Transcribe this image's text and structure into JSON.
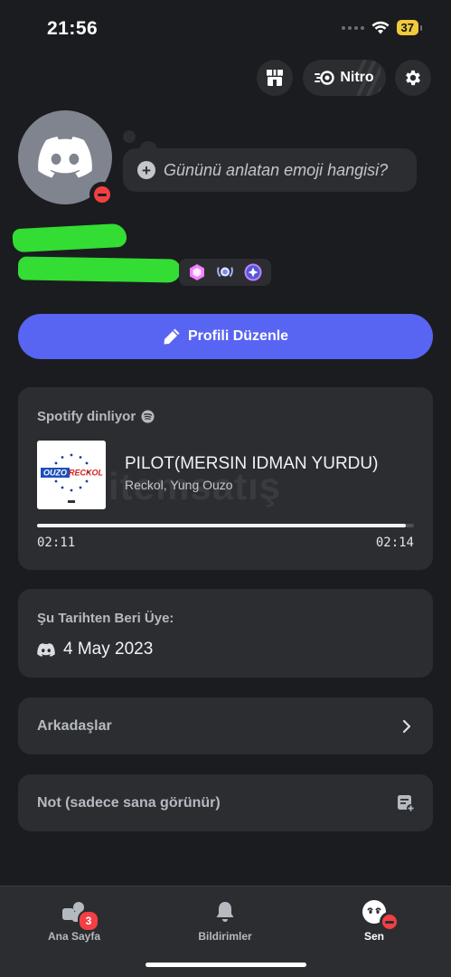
{
  "status_bar": {
    "time": "21:56",
    "battery": "37"
  },
  "header": {
    "nitro_label": "Nitro"
  },
  "profile": {
    "emoji_prompt": "Gününü anlatan emoji hangisi?",
    "edit_button": "Profili Düzenle",
    "badges": [
      "hypesquad-badge",
      "quest-badge",
      "nitro-badge"
    ],
    "status": "do-not-disturb"
  },
  "spotify": {
    "header": "Spotify dinliyor",
    "song_title": "PILOT(MERSIN IDMAN YURDU)",
    "artist": "Reckol, Yung Ouzo",
    "album_logo_text": [
      "OUZO",
      "RECKOL"
    ],
    "elapsed": "02:11",
    "duration": "02:14",
    "progress": 0.978,
    "watermark": "itemsatış"
  },
  "membership": {
    "title": "Şu Tarihten Beri Üye:",
    "date": "4 May 2023"
  },
  "friends": {
    "label": "Arkadaşlar"
  },
  "note": {
    "label": "Not (sadece sana görünür)"
  },
  "tabbar": {
    "home_label": "Ana Sayfa",
    "home_badge": "3",
    "notifications_label": "Bildirimler",
    "you_label": "Sen"
  },
  "colors": {
    "accent": "#5865f2",
    "background": "#1b1c20",
    "card": "#2b2d31",
    "danger": "#f23f43",
    "highlight_scribble": "#33dd33"
  }
}
